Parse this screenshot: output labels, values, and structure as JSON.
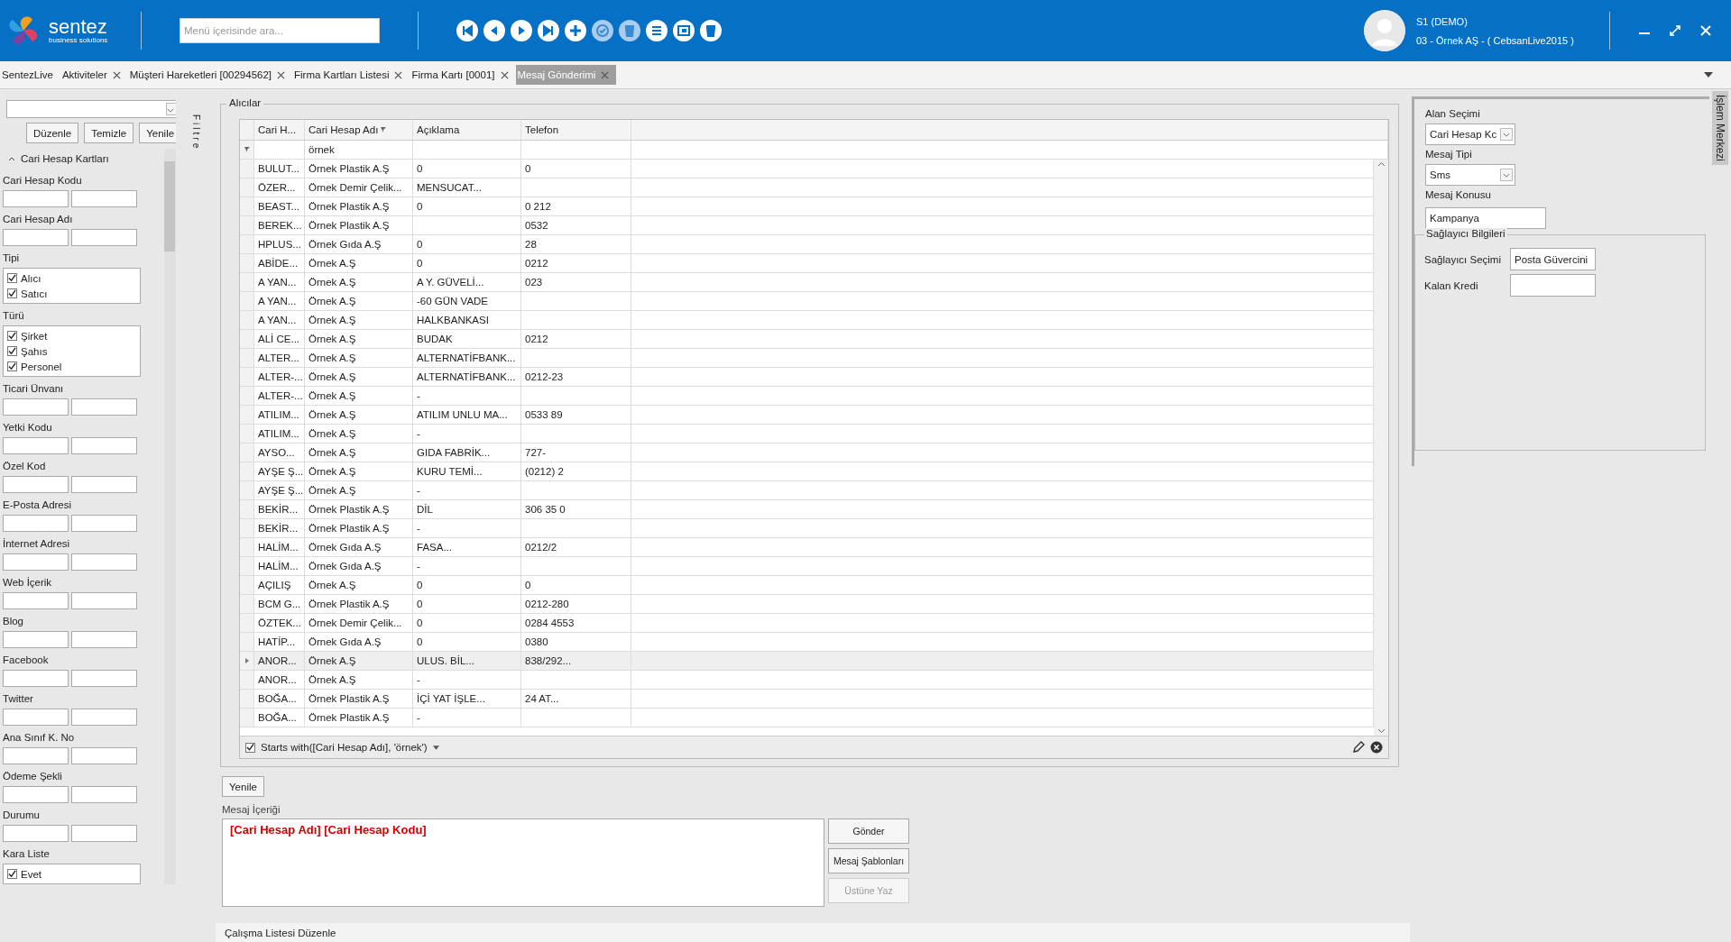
{
  "header": {
    "logo": {
      "name": "sentez",
      "tagline": "business solutions"
    },
    "search": {
      "placeholder": "Menü içerisinde ara..."
    },
    "toolbar": [
      {
        "kind": "first",
        "disabled": false
      },
      {
        "kind": "prev",
        "disabled": false
      },
      {
        "kind": "play",
        "disabled": false
      },
      {
        "kind": "last",
        "disabled": false
      },
      {
        "kind": "add",
        "disabled": false
      },
      {
        "kind": "check",
        "disabled": true
      },
      {
        "kind": "delete",
        "disabled": true
      },
      {
        "kind": "list",
        "disabled": false
      },
      {
        "kind": "window",
        "disabled": false
      },
      {
        "kind": "delete",
        "disabled": false
      }
    ],
    "user": {
      "name": "S1 (DEMO)",
      "company": "03 - Örnek AŞ - ( CebsanLive2015 )"
    }
  },
  "tabs": [
    {
      "label": "SentezLive",
      "closable": false,
      "selected": false
    },
    {
      "label": "Aktiviteler",
      "closable": true,
      "selected": false
    },
    {
      "label": "Müşteri Hareketleri [00294562]",
      "closable": true,
      "selected": false
    },
    {
      "label": "Firma Kartları Listesi",
      "closable": true,
      "selected": false
    },
    {
      "label": "Firma Kartı [0001]",
      "closable": true,
      "selected": false
    },
    {
      "label": "Mesaj Gönderimi",
      "closable": true,
      "selected": true
    }
  ],
  "filter_panel": {
    "strip_label": "Filtre",
    "buttons": [
      "Düzenle",
      "Temizle",
      "Yenile"
    ],
    "section": {
      "title": "Cari Hesap Kartları",
      "expanded": true
    },
    "fields": [
      {
        "kind": "range",
        "label": "Cari Hesap Kodu"
      },
      {
        "kind": "range",
        "label": "Cari Hesap Adı"
      },
      {
        "kind": "checks",
        "label": "Tipi",
        "options": [
          {
            "label": "Alıcı",
            "checked": true
          },
          {
            "label": "Satıcı",
            "checked": true
          }
        ]
      },
      {
        "kind": "checks",
        "label": "Türü",
        "options": [
          {
            "label": "Şirket",
            "checked": true
          },
          {
            "label": "Şahıs",
            "checked": true
          },
          {
            "label": "Personel",
            "checked": true
          }
        ]
      },
      {
        "kind": "range",
        "label": "Ticari Ünvanı"
      },
      {
        "kind": "range",
        "label": "Yetki Kodu"
      },
      {
        "kind": "range",
        "label": "Özel Kod"
      },
      {
        "kind": "range",
        "label": "E-Posta Adresi"
      },
      {
        "kind": "range",
        "label": "İnternet Adresi"
      },
      {
        "kind": "range",
        "label": "Web İçerik"
      },
      {
        "kind": "range",
        "label": "Blog"
      },
      {
        "kind": "range",
        "label": "Facebook"
      },
      {
        "kind": "range",
        "label": "Twitter"
      },
      {
        "kind": "range",
        "label": "Ana Sınıf K. No"
      },
      {
        "kind": "range",
        "label": "Ödeme Şekli"
      },
      {
        "kind": "range",
        "label": "Durumu"
      },
      {
        "kind": "checks",
        "label": "Kara Liste",
        "options": [
          {
            "label": "Evet",
            "checked": true
          }
        ]
      }
    ]
  },
  "recipients": {
    "title": "Alıcılar",
    "columns": [
      "Cari H...",
      "Cari Hesap Adı",
      "Açıklama",
      "Telefon"
    ],
    "filter_value": "örnek",
    "rows": [
      {
        "code": "BULUT...",
        "name": "Örnek Plastik A.Ş",
        "description": "0",
        "phone": "0",
        "selected": false
      },
      {
        "code": "ÖZER...",
        "name": "Örnek Demir Çelik...",
        "description": "MENSUCAT...",
        "phone": "",
        "selected": false
      },
      {
        "code": "BEAST...",
        "name": "Örnek Plastik A.Ş",
        "description": "0",
        "phone": "0 212",
        "selected": false
      },
      {
        "code": "BEREK...",
        "name": "Örnek Plastik A.Ş",
        "description": "",
        "phone": "0532",
        "selected": false
      },
      {
        "code": "HPLUS...",
        "name": "Örnek Gıda A.Ş",
        "description": "0",
        "phone": "28",
        "selected": false
      },
      {
        "code": "ABİDE...",
        "name": "Örnek  A.Ş",
        "description": "0",
        "phone": "0212",
        "selected": false
      },
      {
        "code": "A YAN...",
        "name": "Örnek  A.Ş",
        "description": "A Y. GÜVELİ...",
        "phone": "023",
        "selected": false
      },
      {
        "code": "A YAN...",
        "name": "Örnek  A.Ş",
        "description": "-60 GÜN VADE",
        "phone": "",
        "selected": false
      },
      {
        "code": "A YAN...",
        "name": "Örnek  A.Ş",
        "description": "HALKBANKASI",
        "phone": "",
        "selected": false
      },
      {
        "code": "ALİ CE...",
        "name": "Örnek  A.Ş",
        "description": "BUDAK",
        "phone": "0212",
        "selected": false
      },
      {
        "code": "ALTER...",
        "name": "Örnek  A.Ş",
        "description": "ALTERNATİFBANK...",
        "phone": "",
        "selected": false
      },
      {
        "code": "ALTER-...",
        "name": "Örnek  A.Ş",
        "description": "ALTERNATİFBANK...",
        "phone": "0212-23",
        "selected": false
      },
      {
        "code": "ALTER-...",
        "name": "Örnek  A.Ş",
        "description": "-",
        "phone": "",
        "selected": false
      },
      {
        "code": "ATILIM...",
        "name": "Örnek  A.Ş",
        "description": "ATILIM UNLU MA...",
        "phone": "0533 89",
        "selected": false
      },
      {
        "code": "ATILIM...",
        "name": "Örnek  A.Ş",
        "description": "-",
        "phone": "",
        "selected": false
      },
      {
        "code": "AYSO...",
        "name": "Örnek  A.Ş",
        "description": "GIDA FABRİK...",
        "phone": "727-",
        "selected": false
      },
      {
        "code": "AYŞE Ş...",
        "name": "Örnek  A.Ş",
        "description": "KURU TEMİ...",
        "phone": "(0212) 2",
        "selected": false
      },
      {
        "code": "AYŞE Ş...",
        "name": "Örnek  A.Ş",
        "description": "-",
        "phone": "",
        "selected": false
      },
      {
        "code": "BEKİR...",
        "name": "Örnek Plastik A.Ş",
        "description": "DİL",
        "phone": "306 35 0",
        "selected": false
      },
      {
        "code": "BEKİR...",
        "name": "Örnek Plastik A.Ş",
        "description": "-",
        "phone": "",
        "selected": false
      },
      {
        "code": "HALİM...",
        "name": "Örnek Gıda A.Ş",
        "description": "FASA...",
        "phone": "0212/2",
        "selected": false
      },
      {
        "code": "HALİM...",
        "name": "Örnek Gıda A.Ş",
        "description": "-",
        "phone": "",
        "selected": false
      },
      {
        "code": "AÇILIŞ",
        "name": "Örnek  A.Ş",
        "description": "0",
        "phone": "0",
        "selected": false
      },
      {
        "code": "BCM G...",
        "name": "Örnek Plastik A.Ş",
        "description": "0",
        "phone": "0212-280",
        "selected": false
      },
      {
        "code": "ÖZTEK...",
        "name": "Örnek Demir Çelik...",
        "description": "0",
        "phone": "0284 4553",
        "selected": false
      },
      {
        "code": "HATİP...",
        "name": "Örnek Gıda A.Ş",
        "description": "0",
        "phone": "0380",
        "selected": false
      },
      {
        "code": "ANOR...",
        "name": "Örnek  A.Ş",
        "description": "ULUS. BİL...",
        "phone": "838/292...",
        "selected": true
      },
      {
        "code": "ANOR...",
        "name": "Örnek  A.Ş",
        "description": "-",
        "phone": "",
        "selected": false
      },
      {
        "code": "BOĞA...",
        "name": "Örnek Plastik A.Ş",
        "description": "İÇİ YAT İŞLE...",
        "phone": "24 AT...",
        "selected": false
      },
      {
        "code": "BOĞA...",
        "name": "Örnek Plastik A.Ş",
        "description": "-",
        "phone": "",
        "selected": false
      }
    ],
    "filter_bar": {
      "checked": true,
      "expression": "Starts with([Cari Hesap Adı], 'örnek')"
    }
  },
  "refresh_button": "Yenile",
  "message": {
    "label": "Mesaj İçeriği",
    "value": "[Cari Hesap Adı] [Cari Hesap Kodu]",
    "buttons": [
      {
        "label": "Gönder",
        "disabled": false
      },
      {
        "label": "Mesaj Şablonları",
        "disabled": false
      },
      {
        "label": "Üstüne Yaz",
        "disabled": true
      }
    ]
  },
  "settings": {
    "fields": [
      {
        "kind": "select",
        "label": "Alan Seçimi",
        "value": "Cari Hesap Kc"
      },
      {
        "kind": "select",
        "label": "Mesaj Tipi",
        "value": "Sms"
      },
      {
        "kind": "text",
        "label": "Mesaj Konusu",
        "value": "Kampanya"
      }
    ],
    "provider": {
      "title": "Sağlayıcı Bilgileri",
      "fields": [
        {
          "label": "Sağlayıcı Seçimi",
          "value": "Posta Güvercini"
        },
        {
          "label": "Kalan Kredi"
        }
      ]
    }
  },
  "side_strip_label": "İşlem Merkezi",
  "bottom_bar": "Çalışma Listesi Düzenle"
}
